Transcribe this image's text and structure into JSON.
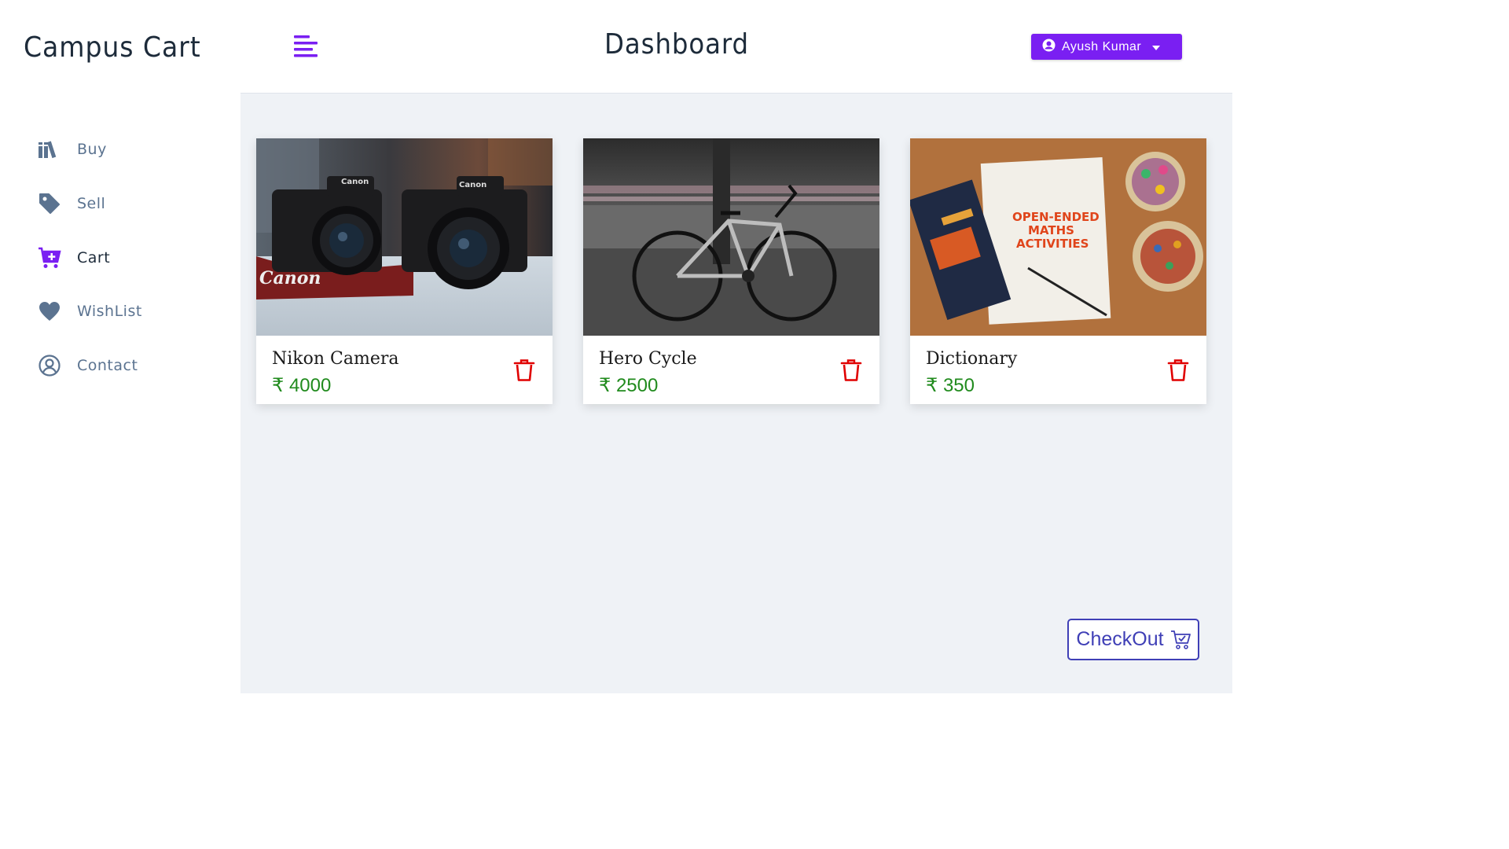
{
  "app": {
    "brand": "Campus Cart",
    "page_title": "Dashboard"
  },
  "header": {
    "user_name": "Ayush Kumar",
    "accent": "#7a1ff2"
  },
  "sidebar": {
    "items": [
      {
        "label": "Buy",
        "icon": "books-icon",
        "active": false
      },
      {
        "label": "Sell",
        "icon": "tag-icon",
        "active": false
      },
      {
        "label": "Cart",
        "icon": "cart-plus-icon",
        "active": true
      },
      {
        "label": "WishList",
        "icon": "heart-icon",
        "active": false
      },
      {
        "label": "Contact",
        "icon": "user-circle-icon",
        "active": false
      }
    ]
  },
  "cart_items": [
    {
      "name": "Nikon Camera",
      "price": "₹ 4000",
      "image": "two canon cameras photo"
    },
    {
      "name": "Hero Cycle",
      "price": "₹ 2500",
      "image": "bicycle photo"
    },
    {
      "name": "Dictionary",
      "price": "₹ 350",
      "image": "books and pencils photo"
    }
  ],
  "checkout": {
    "label": "CheckOut"
  },
  "colors": {
    "price": "#218b1e",
    "trash": "#e00000",
    "checkout": "#3f3fb6",
    "sidebar_text": "#5b7390"
  }
}
